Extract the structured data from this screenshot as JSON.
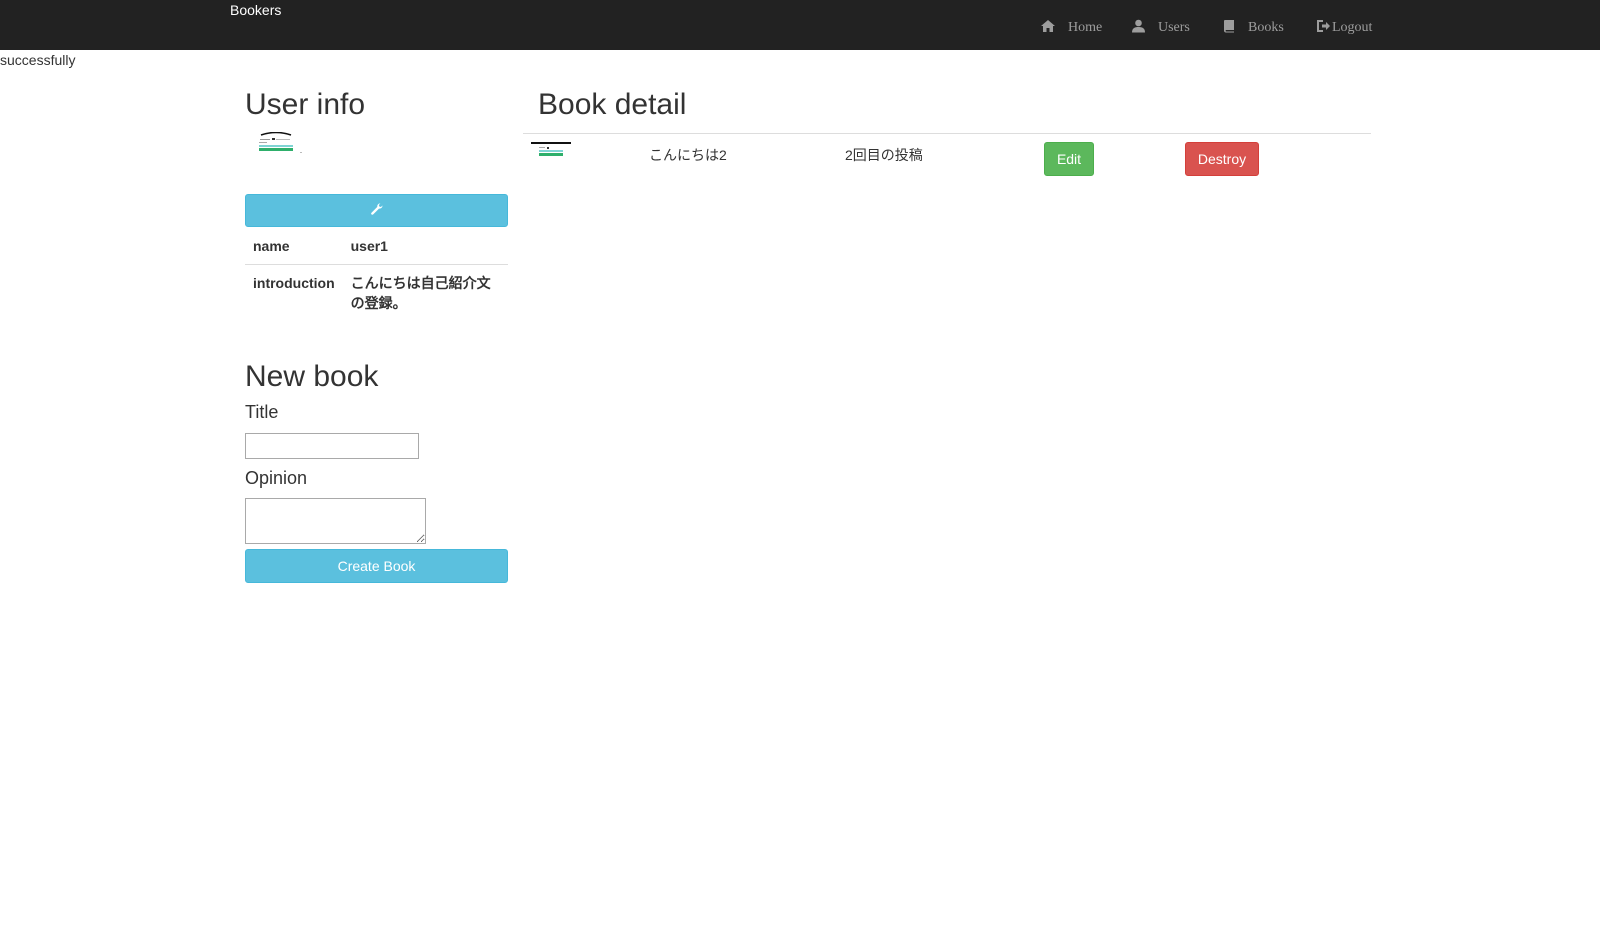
{
  "navbar": {
    "brand": "Bookers",
    "items": [
      {
        "label": "Home",
        "icon": "home-icon"
      },
      {
        "label": "Users",
        "icon": "user-icon"
      },
      {
        "label": "Books",
        "icon": "book-icon"
      },
      {
        "label": "Logout",
        "icon": "logout-icon"
      }
    ]
  },
  "flash": "successfully",
  "user_info": {
    "heading": "User info",
    "edit_icon": "wrench-icon",
    "rows": [
      {
        "key": "name",
        "value": "user1"
      },
      {
        "key": "introduction",
        "value": "こんにちは自己紹介文の登録。"
      }
    ]
  },
  "new_book": {
    "heading": "New book",
    "title_label": "Title",
    "title_value": "",
    "opinion_label": "Opinion",
    "opinion_value": "",
    "submit_label": "Create Book"
  },
  "book_detail": {
    "heading": "Book detail",
    "book": {
      "title": "こんにちは2",
      "opinion": "2回目の投稿",
      "edit_label": "Edit",
      "destroy_label": "Destroy"
    }
  },
  "colors": {
    "navbar_bg": "#222222",
    "info": "#5bc0de",
    "success": "#5cb85c",
    "danger": "#d9534f"
  }
}
